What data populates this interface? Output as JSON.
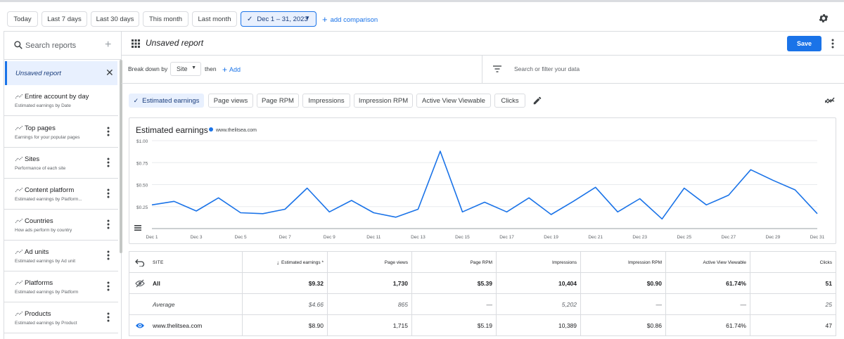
{
  "date_bar": {
    "chips": [
      "Today",
      "Last 7 days",
      "Last 30 days",
      "This month",
      "Last month"
    ],
    "selected_range": "Dec 1 – 31, 2023",
    "add_comparison": "add comparison"
  },
  "sidebar": {
    "search_placeholder": "Search reports",
    "active_report": "Unsaved report",
    "reports": [
      {
        "title": "Entire account by day",
        "subtitle": "Estimated earnings by Date"
      },
      {
        "title": "Top pages",
        "subtitle": "Earnings for your popular pages"
      },
      {
        "title": "Sites",
        "subtitle": "Performance of each site"
      },
      {
        "title": "Content platform",
        "subtitle": "Estimated earnings by Platform..."
      },
      {
        "title": "Countries",
        "subtitle": "How ads perform by country"
      },
      {
        "title": "Ad units",
        "subtitle": "Estimated earnings by Ad unit"
      },
      {
        "title": "Platforms",
        "subtitle": "Estimated earnings by Platform"
      },
      {
        "title": "Products",
        "subtitle": "Estimated earnings by Product"
      }
    ]
  },
  "header": {
    "title": "Unsaved report",
    "save_label": "Save"
  },
  "breakdown": {
    "label": "Break down by",
    "dimension": "Site",
    "then": "then",
    "add": "Add",
    "filter_placeholder": "Search or filter your data"
  },
  "metrics": [
    "Estimated earnings",
    "Page views",
    "Page RPM",
    "Impressions",
    "Impression RPM",
    "Active View Viewable",
    "Clicks"
  ],
  "chart": {
    "title": "Estimated earnings",
    "legend": "www.thelitsea.com",
    "line_color": "#1a73e8"
  },
  "chart_data": {
    "type": "line",
    "title": "Estimated earnings",
    "x": [
      "Dec 1",
      "Dec 2",
      "Dec 3",
      "Dec 4",
      "Dec 5",
      "Dec 6",
      "Dec 7",
      "Dec 8",
      "Dec 9",
      "Dec 10",
      "Dec 11",
      "Dec 12",
      "Dec 13",
      "Dec 14",
      "Dec 15",
      "Dec 16",
      "Dec 17",
      "Dec 18",
      "Dec 19",
      "Dec 20",
      "Dec 21",
      "Dec 22",
      "Dec 23",
      "Dec 24",
      "Dec 25",
      "Dec 26",
      "Dec 27",
      "Dec 28",
      "Dec 29",
      "Dec 30",
      "Dec 31"
    ],
    "x_tick_labels": [
      "Dec 1",
      "Dec 3",
      "Dec 5",
      "Dec 7",
      "Dec 9",
      "Dec 11",
      "Dec 13",
      "Dec 15",
      "Dec 17",
      "Dec 19",
      "Dec 21",
      "Dec 23",
      "Dec 25",
      "Dec 27",
      "Dec 29",
      "Dec 31"
    ],
    "series": [
      {
        "name": "www.thelitsea.com",
        "values": [
          0.27,
          0.31,
          0.2,
          0.35,
          0.18,
          0.17,
          0.22,
          0.46,
          0.19,
          0.32,
          0.18,
          0.13,
          0.22,
          0.88,
          0.19,
          0.3,
          0.19,
          0.35,
          0.16,
          0.31,
          0.47,
          0.19,
          0.34,
          0.11,
          0.46,
          0.27,
          0.38,
          0.67,
          0.55,
          0.44,
          0.17
        ]
      }
    ],
    "y_ticks": [
      "$1.00",
      "$0.75",
      "$0.50",
      "$0.25"
    ],
    "ylim": [
      0,
      1.0
    ],
    "grid": true
  },
  "table": {
    "columns": [
      "Site",
      "Estimated earnings *",
      "Page views",
      "Page RPM",
      "Impressions",
      "Impression RPM",
      "Active View Viewable",
      "Clicks"
    ],
    "rows": [
      {
        "kind": "all",
        "cells": [
          "All",
          "$9.32",
          "1,730",
          "$5.39",
          "10,404",
          "$0.90",
          "61.74%",
          "51"
        ]
      },
      {
        "kind": "avg",
        "cells": [
          "Average",
          "$4.66",
          "865",
          "—",
          "5,202",
          "—",
          "—",
          "25"
        ]
      },
      {
        "kind": "site",
        "cells": [
          "www.thelitsea.com",
          "$8.90",
          "1,715",
          "$5.19",
          "10,389",
          "$0.86",
          "61.74%",
          "47"
        ]
      }
    ]
  }
}
